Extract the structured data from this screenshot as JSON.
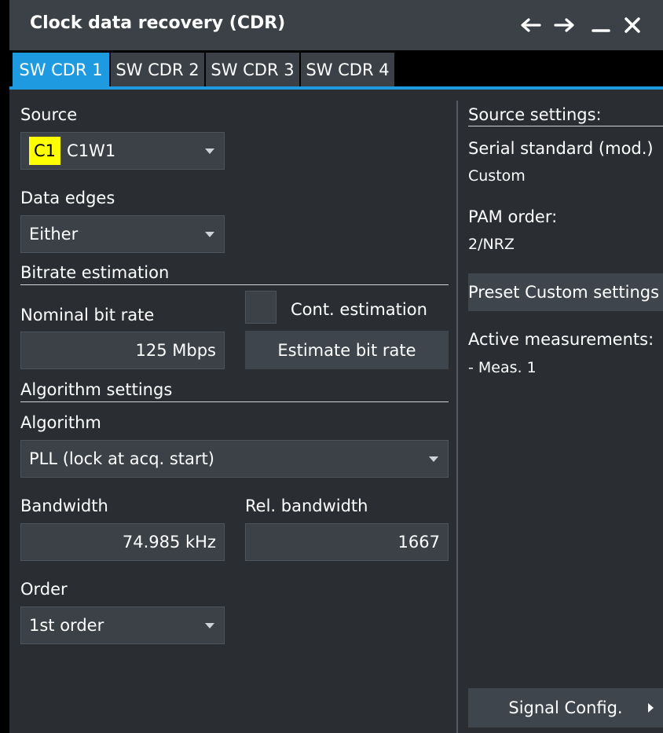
{
  "window": {
    "title": "Clock data recovery (CDR)",
    "icons": [
      "arrow-left-icon",
      "arrow-right-icon",
      "minimize-icon",
      "close-icon"
    ]
  },
  "tabs": [
    {
      "label": "SW CDR 1",
      "active": true
    },
    {
      "label": "SW CDR 2",
      "active": false
    },
    {
      "label": "SW CDR 3",
      "active": false
    },
    {
      "label": "SW CDR 4",
      "active": false
    }
  ],
  "source": {
    "label": "Source",
    "badge": "C1",
    "value": "C1W1",
    "badge_color": "#ffff00"
  },
  "data_edges": {
    "label": "Data edges",
    "value": "Either"
  },
  "bitrate_estimation": {
    "section_label": "Bitrate estimation",
    "nominal_label": "Nominal bit rate",
    "nominal_value": "125 Mbps",
    "cont_label": "Cont. estimation",
    "cont_checked": false,
    "estimate_button": "Estimate bit rate"
  },
  "algorithm_settings": {
    "section_label": "Algorithm settings",
    "algorithm_label": "Algorithm",
    "algorithm_value": "PLL (lock at acq. start)",
    "bandwidth_label": "Bandwidth",
    "bandwidth_value": "74.985 kHz",
    "rel_bandwidth_label": "Rel. bandwidth",
    "rel_bandwidth_value": "1667",
    "order_label": "Order",
    "order_value": "1st order"
  },
  "right_panel": {
    "source_settings_label": "Source settings:",
    "serial_standard_label": "Serial standard (mod.)",
    "serial_standard_value": "Custom",
    "pam_order_label": "PAM order:",
    "pam_order_value": "2/NRZ",
    "preset_button": "Preset Custom settings",
    "active_measurements_label": "Active measurements:",
    "active_measurements_value": "- Meas. 1",
    "signal_config_button": "Signal Config.",
    "signal_config_icon": "triangle-right-icon"
  },
  "colors": {
    "accent": "#1e9ae0",
    "title_bar": "#3b4147",
    "panel_bg": "#2a2e32"
  }
}
